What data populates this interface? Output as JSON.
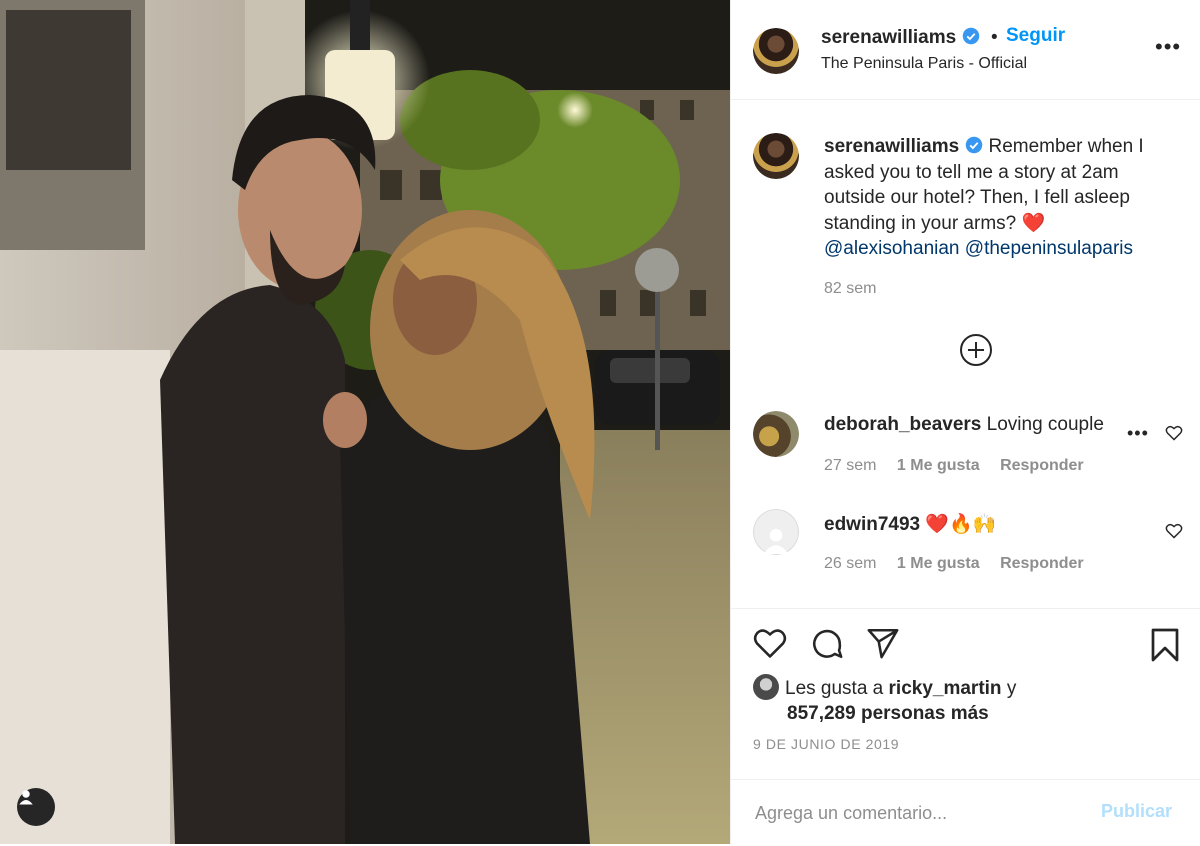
{
  "post": {
    "author": "serenawilliams",
    "follow_label": "Seguir",
    "separator": "•",
    "location": "The Peninsula Paris - Official",
    "more_icon": "more-horizontal-icon",
    "caption": {
      "username": "serenawilliams",
      "text": "Remember when I asked you to tell me a story at 2am outside our hotel? Then, I fell asleep standing in your arms? ❤️",
      "mention1": "@alexisohanian",
      "mention2": "@thepeninsulaparis",
      "time": "82 sem"
    },
    "comments": [
      {
        "username": "deborah_beavers",
        "text": "Loving couple",
        "time": "27 sem",
        "likes": "1 Me gusta",
        "reply": "Responder"
      },
      {
        "username": "edwin7493",
        "text": "❤️🔥🙌",
        "time": "26 sem",
        "likes": "1 Me gusta",
        "reply": "Responder"
      }
    ],
    "likes": {
      "prefix": "Les gusta a",
      "user": "ricky_martin",
      "conj": "y",
      "count_text": "857,289 personas más"
    },
    "date": "9 DE JUNIO DE 2019",
    "add_comment": {
      "placeholder": "Agrega un comentario...",
      "publish_label": "Publicar"
    }
  },
  "colors": {
    "accent": "#0095f6",
    "publish_disabled": "#b2dffc",
    "meta": "#8e8e8e",
    "mention": "#00376b"
  }
}
